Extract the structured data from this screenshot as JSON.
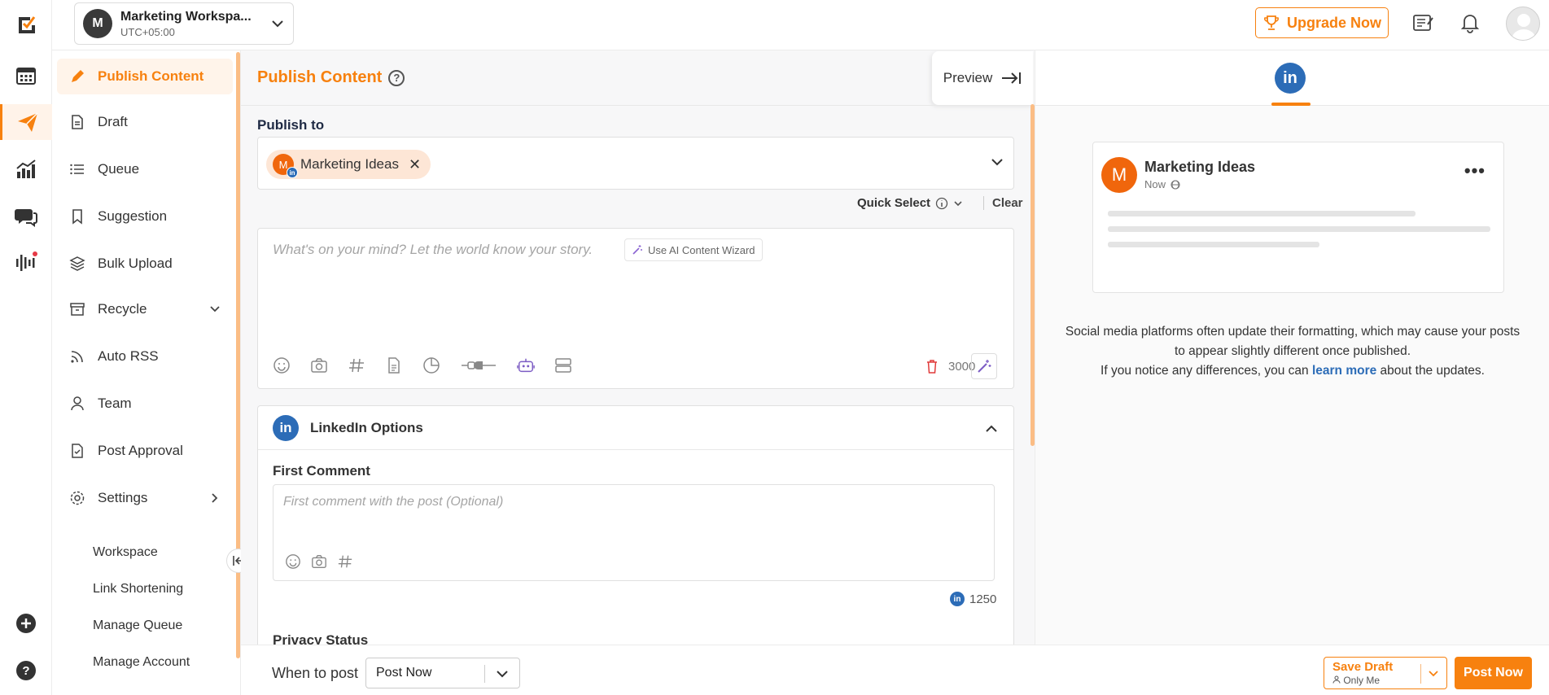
{
  "workspace": {
    "initial": "M",
    "name": "Marketing Workspa...",
    "timezone": "UTC+05:00"
  },
  "topbar": {
    "upgrade_label": "Upgrade Now"
  },
  "sidebar": {
    "items": [
      {
        "label": "Publish Content"
      },
      {
        "label": "Draft"
      },
      {
        "label": "Queue"
      },
      {
        "label": "Suggestion"
      },
      {
        "label": "Bulk Upload"
      },
      {
        "label": "Recycle"
      },
      {
        "label": "Auto RSS"
      },
      {
        "label": "Team"
      },
      {
        "label": "Post Approval"
      },
      {
        "label": "Settings"
      }
    ],
    "settings_sub": [
      "Workspace",
      "Link Shortening",
      "Manage Queue",
      "Manage Account"
    ]
  },
  "main": {
    "title": "Publish Content",
    "help_glyph": "?",
    "preview_label": "Preview",
    "publish_to_label": "Publish to",
    "account_chip": {
      "initial": "M",
      "network_badge": "in",
      "name": "Marketing Ideas"
    },
    "quick_select_label": "Quick Select",
    "clear_label": "Clear",
    "editor_placeholder": "What's on your mind? Let the world know your story.",
    "ai_wizard_label": "Use AI Content Wizard",
    "char_count": "3000",
    "linkedin_options": {
      "title": "LinkedIn Options",
      "badge": "in",
      "first_comment_label": "First Comment",
      "first_comment_placeholder": "First comment with the post (Optional)",
      "comment_count": "1250",
      "privacy_status_label": "Privacy Status"
    }
  },
  "bottom": {
    "when_to_post_label": "When to post",
    "when_to_post_value": "Post Now",
    "save_draft_label": "Save Draft",
    "save_draft_visibility": "Only Me",
    "post_now_label": "Post Now"
  },
  "preview_panel": {
    "tab_badge": "in",
    "card": {
      "initial": "M",
      "name": "Marketing Ideas",
      "time": "Now"
    },
    "note_line1": "Social media platforms often update their formatting, which may cause your posts to appear slightly different once published.",
    "note_line2_pre": "If you notice any differences, you can ",
    "note_link": "learn more",
    "note_line2_post": " about the updates."
  },
  "colors": {
    "accent": "#f7810f",
    "linkedin": "#2c6cb7",
    "avatar_orange": "#f0660c"
  }
}
